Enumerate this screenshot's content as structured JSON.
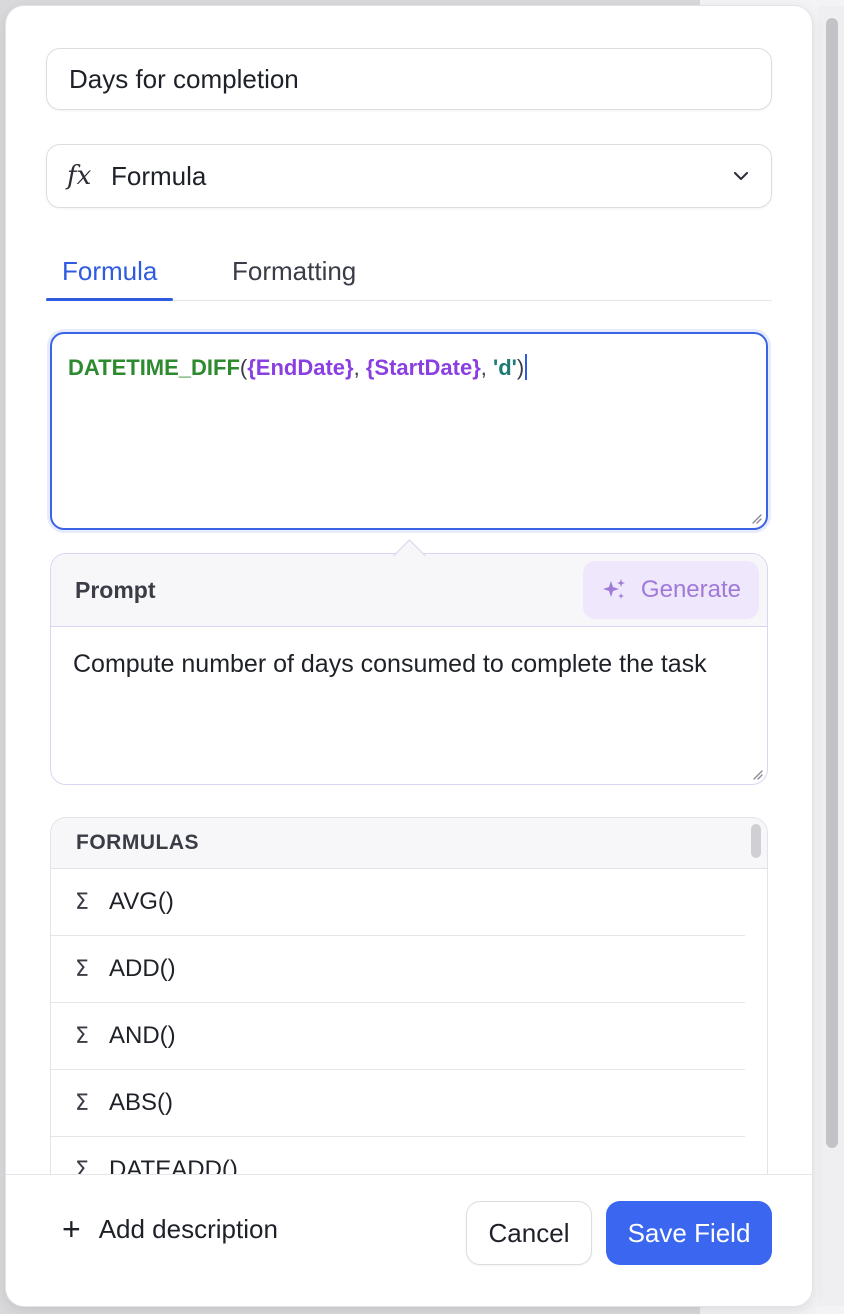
{
  "field_name": {
    "value": "Days for completion"
  },
  "field_type": {
    "label": "Formula",
    "icon": "fx-icon"
  },
  "tabs": [
    {
      "label": "Formula",
      "active": true
    },
    {
      "label": "Formatting",
      "active": false
    }
  ],
  "formula": {
    "function": "DATETIME_DIFF",
    "open_paren": "(",
    "arg1": "{EndDate}",
    "sep1": ", ",
    "arg2": "{StartDate}",
    "sep2": ", ",
    "arg3": "'d'",
    "close_paren": ")"
  },
  "prompt": {
    "title": "Prompt",
    "generate_label": "Generate",
    "text": "Compute number of days consumed to complete the task"
  },
  "formulas_list": {
    "header": "FORMULAS",
    "items": [
      "AVG()",
      "ADD()",
      "AND()",
      "ABS()",
      "DATEADD()"
    ]
  },
  "footer": {
    "add_description": "Add description",
    "cancel": "Cancel",
    "save": "Save Field"
  },
  "colors": {
    "accent": "#3a66f0",
    "function_green": "#2d8a2e",
    "field_purple": "#8a3fe0",
    "string_teal": "#1e7a72",
    "generate_purple": "#a07ad9"
  }
}
